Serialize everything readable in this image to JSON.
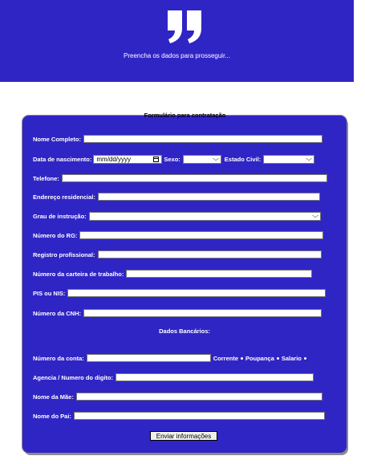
{
  "header": {
    "background": "#2f25c5",
    "icon": "quote-icon",
    "tagline": "Preencha os dados para prosseguir..."
  },
  "form": {
    "title": "Formulário para contratação",
    "fields": {
      "nome_completo": "Nome Completo:",
      "data_nascimento": "Data de nascimento:",
      "data_placeholder": "mm/dd/yyyy",
      "sexo": "Sexo:",
      "estado_civil": "Estado Civil:",
      "telefone": "Telefone:",
      "endereco": "Endereço residencial:",
      "grau_instrucao": "Grau de instrução:",
      "rg": "Número do RG:",
      "registro": "Registro profissional:",
      "carteira": "Número da carteira de trabalho:",
      "pis": "PIS ou NIS:",
      "cnh": "Número da CNH:"
    },
    "bank": {
      "title": "Dados Bancários:",
      "conta": "Número da conta:",
      "options": [
        "Corrente",
        "Poupança",
        "Salario"
      ],
      "agencia": "Agencia / Numero do digito:"
    },
    "parents": {
      "mae": "Nome da Mãe:",
      "pai": "Nome do Pai:"
    },
    "submit_label": "Enviar informações"
  }
}
